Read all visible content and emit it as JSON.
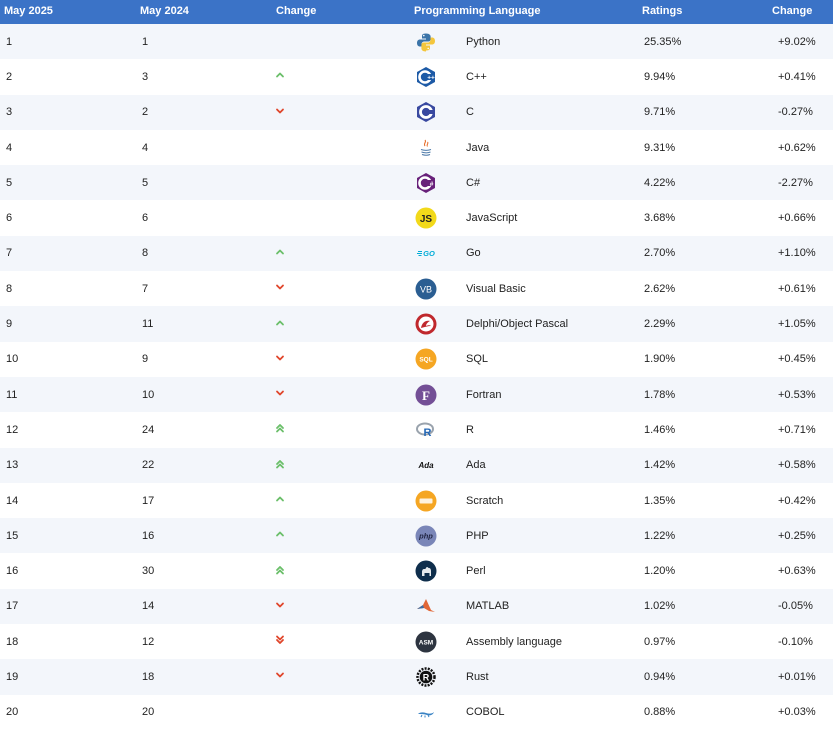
{
  "header": {
    "may2025": "May 2025",
    "may2024": "May 2024",
    "change": "Change",
    "language": "Programming Language",
    "ratings": "Ratings",
    "change2": "Change"
  },
  "colors": {
    "header_bg": "#3b73c7",
    "up": "#6abf69",
    "down": "#e0452a"
  },
  "rows": [
    {
      "rank2025": "1",
      "rank2024": "1",
      "trend": "none",
      "logo": "python-logo",
      "language": "Python",
      "rating": "25.35%",
      "change": "+9.02%"
    },
    {
      "rank2025": "2",
      "rank2024": "3",
      "trend": "up",
      "logo": "cpp-logo",
      "language": "C++",
      "rating": "9.94%",
      "change": "+0.41%"
    },
    {
      "rank2025": "3",
      "rank2024": "2",
      "trend": "down",
      "logo": "c-logo",
      "language": "C",
      "rating": "9.71%",
      "change": "-0.27%"
    },
    {
      "rank2025": "4",
      "rank2024": "4",
      "trend": "none",
      "logo": "java-logo",
      "language": "Java",
      "rating": "9.31%",
      "change": "+0.62%"
    },
    {
      "rank2025": "5",
      "rank2024": "5",
      "trend": "none",
      "logo": "csharp-logo",
      "language": "C#",
      "rating": "4.22%",
      "change": "-2.27%"
    },
    {
      "rank2025": "6",
      "rank2024": "6",
      "trend": "none",
      "logo": "javascript-logo",
      "language": "JavaScript",
      "rating": "3.68%",
      "change": "+0.66%"
    },
    {
      "rank2025": "7",
      "rank2024": "8",
      "trend": "up",
      "logo": "go-logo",
      "language": "Go",
      "rating": "2.70%",
      "change": "+1.10%"
    },
    {
      "rank2025": "8",
      "rank2024": "7",
      "trend": "down",
      "logo": "vb-logo",
      "language": "Visual Basic",
      "rating": "2.62%",
      "change": "+0.61%"
    },
    {
      "rank2025": "9",
      "rank2024": "11",
      "trend": "up",
      "logo": "delphi-logo",
      "language": "Delphi/Object Pascal",
      "rating": "2.29%",
      "change": "+1.05%"
    },
    {
      "rank2025": "10",
      "rank2024": "9",
      "trend": "down",
      "logo": "sql-logo",
      "language": "SQL",
      "rating": "1.90%",
      "change": "+0.45%"
    },
    {
      "rank2025": "11",
      "rank2024": "10",
      "trend": "down",
      "logo": "fortran-logo",
      "language": "Fortran",
      "rating": "1.78%",
      "change": "+0.53%"
    },
    {
      "rank2025": "12",
      "rank2024": "24",
      "trend": "upup",
      "logo": "r-logo",
      "language": "R",
      "rating": "1.46%",
      "change": "+0.71%"
    },
    {
      "rank2025": "13",
      "rank2024": "22",
      "trend": "upup",
      "logo": "ada-logo",
      "language": "Ada",
      "rating": "1.42%",
      "change": "+0.58%"
    },
    {
      "rank2025": "14",
      "rank2024": "17",
      "trend": "up",
      "logo": "scratch-logo",
      "language": "Scratch",
      "rating": "1.35%",
      "change": "+0.42%"
    },
    {
      "rank2025": "15",
      "rank2024": "16",
      "trend": "up",
      "logo": "php-logo",
      "language": "PHP",
      "rating": "1.22%",
      "change": "+0.25%"
    },
    {
      "rank2025": "16",
      "rank2024": "30",
      "trend": "upup",
      "logo": "perl-logo",
      "language": "Perl",
      "rating": "1.20%",
      "change": "+0.63%"
    },
    {
      "rank2025": "17",
      "rank2024": "14",
      "trend": "down",
      "logo": "matlab-logo",
      "language": "MATLAB",
      "rating": "1.02%",
      "change": "-0.05%"
    },
    {
      "rank2025": "18",
      "rank2024": "12",
      "trend": "downdown",
      "logo": "assembly-logo",
      "language": "Assembly language",
      "rating": "0.97%",
      "change": "-0.10%"
    },
    {
      "rank2025": "19",
      "rank2024": "18",
      "trend": "down",
      "logo": "rust-logo",
      "language": "Rust",
      "rating": "0.94%",
      "change": "+0.01%"
    },
    {
      "rank2025": "20",
      "rank2024": "20",
      "trend": "none",
      "logo": "cobol-logo",
      "language": "COBOL",
      "rating": "0.88%",
      "change": "+0.03%"
    }
  ]
}
